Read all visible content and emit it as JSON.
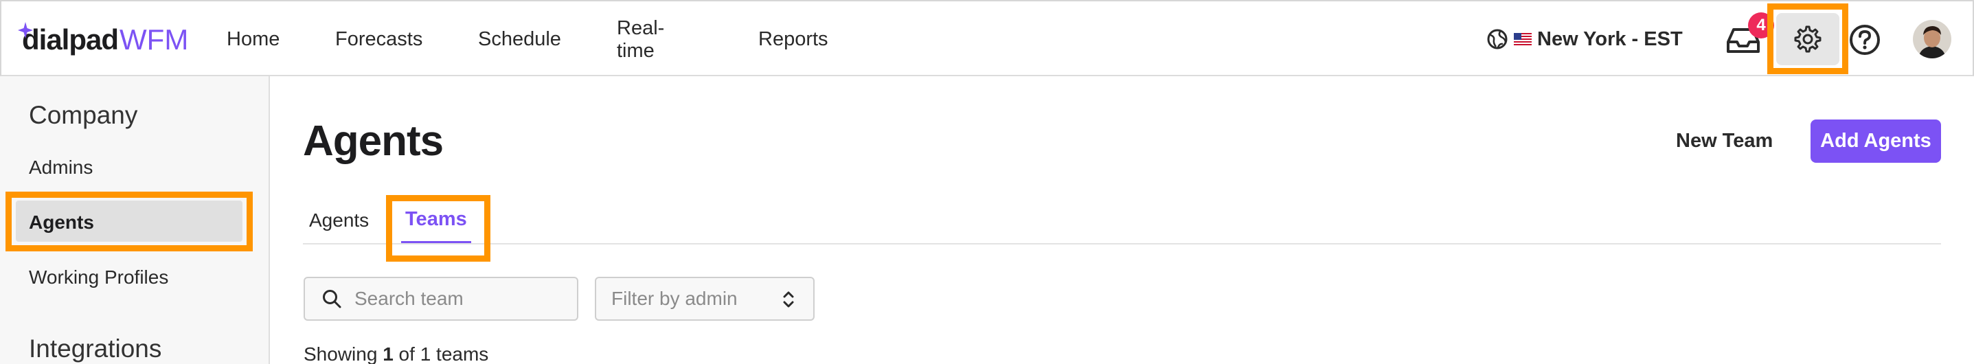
{
  "brand": {
    "name": "dialpad",
    "product": "WFM",
    "accent": "#7c52f4"
  },
  "nav": {
    "items": [
      "Home",
      "Forecasts",
      "Schedule",
      "Real-time",
      "Reports"
    ]
  },
  "header": {
    "timezone": "New York - EST",
    "inbox_badge": "4"
  },
  "sidebar": {
    "section1": "Company",
    "items": [
      "Admins",
      "Agents",
      "Working Profiles"
    ],
    "active": "Agents",
    "section2": "Integrations"
  },
  "main": {
    "title": "Agents",
    "new_team_label": "New Team",
    "add_agents_label": "Add Agents",
    "tabs": [
      "Agents",
      "Teams"
    ],
    "active_tab": "Teams",
    "search_placeholder": "Search team",
    "filter_placeholder": "Filter by admin",
    "showing": {
      "prefix": "Showing",
      "count": "1",
      "middle": "of",
      "total": "1",
      "suffix": "teams"
    }
  },
  "colors": {
    "highlight": "#ff9500",
    "badge": "#ee2a5a"
  }
}
